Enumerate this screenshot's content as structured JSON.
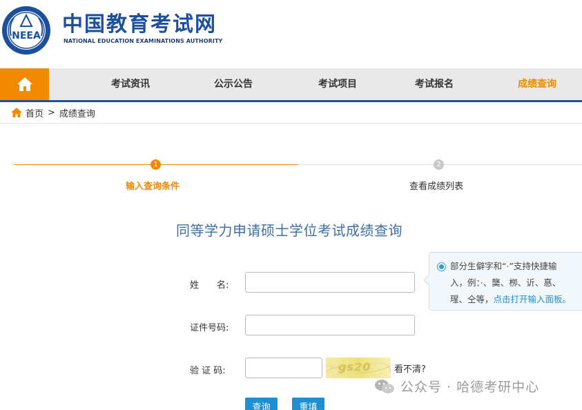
{
  "brand": {
    "title_cn": "中国教育考试网",
    "title_en": "NATIONAL EDUCATION EXAMINATIONS AUTHORITY",
    "logo_text": "NEEA",
    "primary_color": "#1c4f9c",
    "accent_color": "#f28a00"
  },
  "nav": {
    "home_icon": "home-icon",
    "items": [
      {
        "label": "考试资讯"
      },
      {
        "label": "公示公告"
      },
      {
        "label": "考试项目"
      },
      {
        "label": "考试报名"
      },
      {
        "label": "成绩查询"
      }
    ]
  },
  "breadcrumb": {
    "icon": "home-icon",
    "home": "首页",
    "separator": ">",
    "current": "成绩查询"
  },
  "steps": [
    {
      "number": "1",
      "label": "输入查询条件"
    },
    {
      "number": "2",
      "label": "查看成绩列表"
    }
  ],
  "form": {
    "title": "同等学力申请硕士学位考试成绩查询",
    "name_label": "姓　　名:",
    "id_label": "证件号码:",
    "captcha_label": "验 证 码:",
    "name_value": "",
    "id_value": "",
    "captcha_value": "",
    "captcha_image_text": "gs20",
    "captcha_refresh": "看不清?",
    "submit_label": "查询",
    "reset_label": "重填"
  },
  "tooltip": {
    "line1": "部分生僻字和“·”支持快捷输",
    "line2": "入，例：·、龑、栁、䜣、惪、",
    "line3_text": "瑆、仝等，",
    "line3_link": "点击打开输入面板。"
  },
  "watermark": {
    "icon": "wechat-icon",
    "text": "公众号 · 哈德考研中心"
  }
}
